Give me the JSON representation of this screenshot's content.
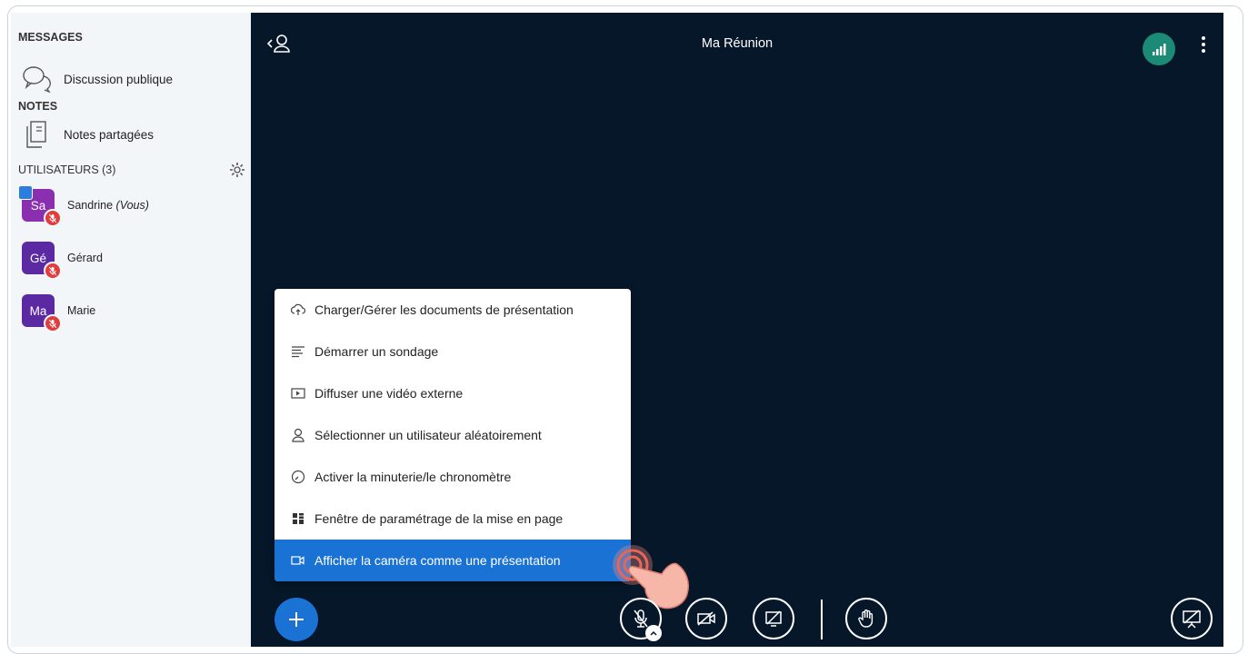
{
  "sidebar": {
    "messages_title": "MESSAGES",
    "public_chat_label": "Discussion publique",
    "notes_title": "NOTES",
    "shared_notes_label": "Notes partagées",
    "users_title": "UTILISATEURS (3)",
    "users": [
      {
        "initials": "Sa",
        "name": "Sandrine",
        "suffix": "(Vous)",
        "color": "#8a2fb0"
      },
      {
        "initials": "Gé",
        "name": "Gérard",
        "suffix": "",
        "color": "#5b2aa3"
      },
      {
        "initials": "Ma",
        "name": "Marie",
        "suffix": "",
        "color": "#5b2aa3"
      }
    ]
  },
  "header": {
    "meeting_title": "Ma Réunion"
  },
  "actions_menu": {
    "items": [
      {
        "label": "Charger/Gérer les documents de présentation",
        "icon": "upload-cloud-icon"
      },
      {
        "label": "Démarrer un sondage",
        "icon": "poll-list-icon"
      },
      {
        "label": "Diffuser une vidéo externe",
        "icon": "external-video-icon"
      },
      {
        "label": "Sélectionner un utilisateur aléatoirement",
        "icon": "user-icon"
      },
      {
        "label": "Activer la minuterie/le chronomètre",
        "icon": "timer-icon"
      },
      {
        "label": "Fenêtre de paramétrage de la mise en page",
        "icon": "layout-icon"
      },
      {
        "label": "Afficher la caméra comme une présentation",
        "icon": "camera-icon",
        "active": true
      }
    ]
  },
  "colors": {
    "main_bg": "#06172a",
    "accent": "#1a73d4",
    "connection_ok": "#1b8a76",
    "muted_mic": "#e03e3e",
    "tap_indicator": "#f08a80"
  }
}
